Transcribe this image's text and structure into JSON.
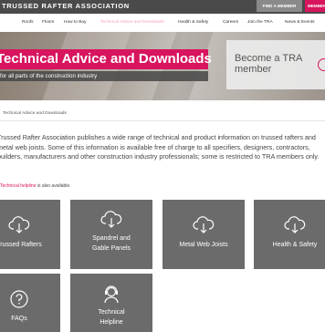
{
  "header": {
    "brand": "TRUSSED RAFTER ASSOCIATION",
    "find_member": "FIND A MEMBER",
    "member_area": "MEMBER"
  },
  "nav": {
    "items": [
      {
        "label": "Roofs"
      },
      {
        "label": "Floors"
      },
      {
        "label": "How to Buy"
      },
      {
        "label": "Technical Advice and Downloads",
        "active": true
      },
      {
        "label": "Health & Safety"
      },
      {
        "label": "Careers"
      },
      {
        "label": "Join the TRA"
      },
      {
        "label": "News & Events"
      }
    ]
  },
  "hero": {
    "title": "Technical Advice and Downloads",
    "subtitle": "for all parts of the construction industry",
    "become_member": "Become a TRA member"
  },
  "breadcrumb": {
    "current": "Technical Advice and Downloads"
  },
  "intro": {
    "paragraph": "Trussed Rafter Association publishes a wide range of technical and product information on trussed rafters and metal web joists. Some of this information is available free of charge to all specifiers, designers, contractors, builders, manufacturers and other construction industry professionals; some is restricted to TRA members only.",
    "helpline_link": "Technical helpline",
    "helpline_suffix": " is also available."
  },
  "cards": [
    {
      "label": "Trussed Rafters",
      "icon": "cloud-download-icon"
    },
    {
      "label": "Spandrel and Gable Panels",
      "icon": "cloud-download-icon"
    },
    {
      "label": "Metal Web Joists",
      "icon": "cloud-download-icon"
    },
    {
      "label": "Health & Safety",
      "icon": "cloud-download-icon"
    },
    {
      "label": "FAQs",
      "icon": "question-circle-icon"
    },
    {
      "label": "Technical Helpline",
      "icon": "headset-icon"
    }
  ],
  "colors": {
    "accent": "#d8145e",
    "topbar": "#4a4a4a",
    "card": "#6b6b6b"
  }
}
